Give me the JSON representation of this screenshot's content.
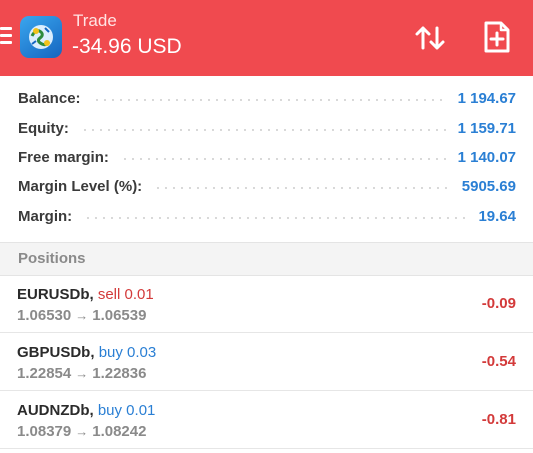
{
  "header": {
    "title": "Trade",
    "floating_pnl": "-34.96 USD",
    "background_color": "#f04a4f",
    "icons": {
      "menu": "hamburger-menu-icon",
      "app": "metatrader-logo-icon",
      "sort": "sort-arrows-icon",
      "new_order": "new-order-document-plus-icon"
    }
  },
  "account": [
    {
      "label": "Balance:",
      "value": "1 194.67"
    },
    {
      "label": "Equity:",
      "value": "1 159.71"
    },
    {
      "label": "Free margin:",
      "value": "1 140.07"
    },
    {
      "label": "Margin Level (%):",
      "value": "5905.69"
    },
    {
      "label": "Margin:",
      "value": "19.64"
    }
  ],
  "positions": {
    "section_title": "Positions",
    "items": [
      {
        "symbol": "EURUSDb,",
        "side": "sell",
        "volume_text": "sell 0.01",
        "open_price": "1.06530",
        "current_price": "1.06539",
        "profit": "-0.09"
      },
      {
        "symbol": "GBPUSDb,",
        "side": "buy",
        "volume_text": "buy 0.03",
        "open_price": "1.22854",
        "current_price": "1.22836",
        "profit": "-0.54"
      },
      {
        "symbol": "AUDNZDb,",
        "side": "buy",
        "volume_text": "buy 0.01",
        "open_price": "1.08379",
        "current_price": "1.08242",
        "profit": "-0.81"
      }
    ]
  },
  "colors": {
    "sell": "#d33a3a",
    "buy": "#2a7fd4",
    "loss": "#d33a3a",
    "value": "#2a7fd4"
  }
}
